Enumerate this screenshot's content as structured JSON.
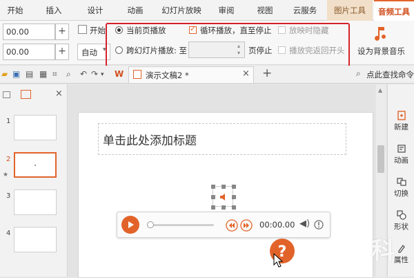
{
  "tabs": [
    "开始",
    "插入",
    "设计",
    "动画",
    "幻灯片放映",
    "审阅",
    "视图",
    "云服务",
    "图片工具",
    "音频工具"
  ],
  "ribbon": {
    "volume_value": "00.00",
    "fade_value": "00.00",
    "start_label": "开始",
    "start_value": "自动",
    "opt_current_page": "当前页播放",
    "opt_cross_slide": "跨幻灯片播放: 至",
    "page_stop": "页停止",
    "loop_label": "循环播放，直至停止",
    "hide_label": "放映时隐藏",
    "rewind_label": "播放完返回开头",
    "bg_music_label": "设为背景音乐"
  },
  "document_tab": "演示文稿2 *",
  "search_label": "点此查找命令",
  "slides": [
    "1",
    "2",
    "3",
    "4"
  ],
  "slide_title_placeholder": "单击此处添加标题",
  "player": {
    "time": "00:00.00"
  },
  "right_panel": [
    "新建",
    "动画",
    "切换",
    "形状",
    "属性"
  ],
  "watermark": "科",
  "colors": {
    "accent": "#e2632a",
    "highlight": "#d4222a"
  }
}
